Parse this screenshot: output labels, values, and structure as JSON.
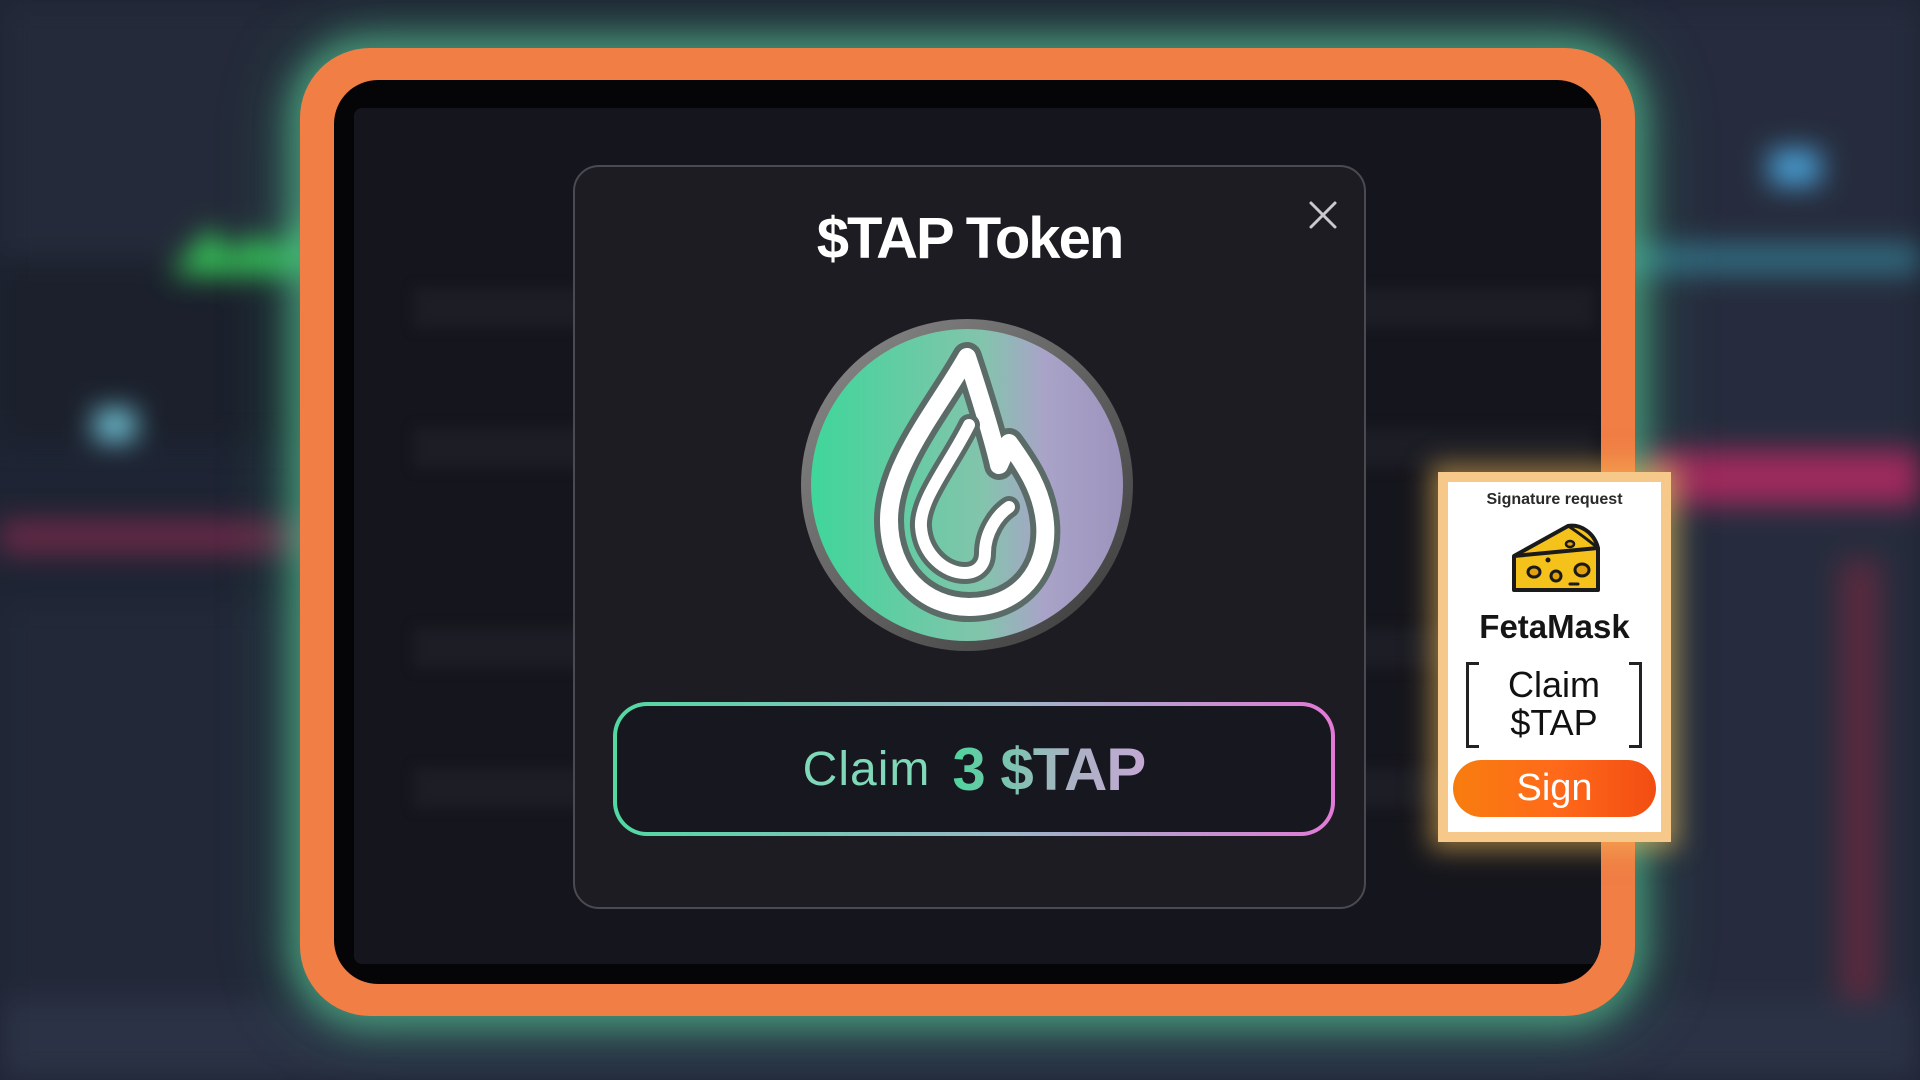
{
  "modal": {
    "title": "$TAP Token",
    "close_icon": "close-icon",
    "logo_icon": "tap-drop-icon",
    "claim_button": {
      "prefix": "Claim",
      "amount": "3 $TAP"
    }
  },
  "signature_request": {
    "title": "Signature request",
    "wallet_icon": "cheese-icon",
    "wallet_name": "FetaMask",
    "message_lines": [
      "Claim",
      "$TAP"
    ],
    "sign_label": "Sign"
  },
  "colors": {
    "frame": "#f07e45",
    "frame_glow": "#5ac896",
    "modal_bg": "#1c1c22",
    "claim_green": "#52d9a2",
    "claim_pink": "#e27ad6",
    "sign_orange": "#f77d0f"
  }
}
